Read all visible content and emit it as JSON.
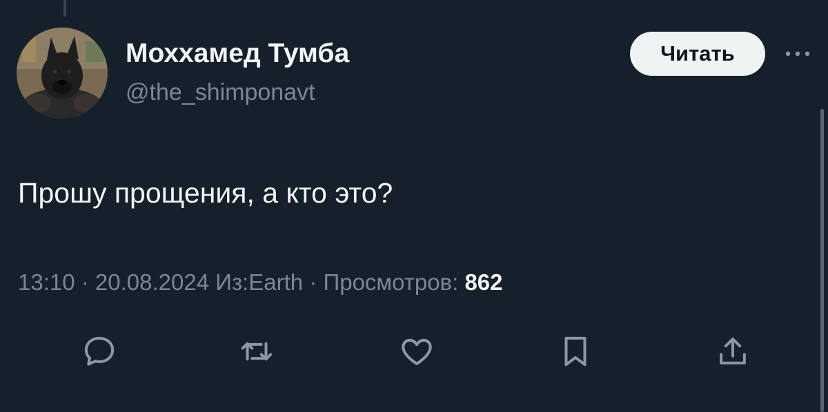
{
  "author": {
    "display_name": "Мохxамед Тумба",
    "handle": "@the_shimponavt"
  },
  "follow_button": {
    "label": "Читать"
  },
  "tweet": {
    "text": "Прошу прощения, а кто это?"
  },
  "meta": {
    "time": "13:10",
    "separator": " · ",
    "date": "20.08.2024",
    "source": "Из:Earth",
    "views_label": "Просмотров: ",
    "views_count": "862"
  },
  "actions": [
    {
      "name": "reply",
      "icon": "speech-bubble-icon"
    },
    {
      "name": "repost",
      "icon": "repost-arrows-icon"
    },
    {
      "name": "like",
      "icon": "heart-icon"
    },
    {
      "name": "bookmark",
      "icon": "bookmark-icon"
    },
    {
      "name": "share",
      "icon": "share-upload-icon"
    }
  ],
  "colors": {
    "background": "#15202b",
    "primary_text": "#f2f4f5",
    "secondary_text": "#7b8793",
    "icon": "#8b98a5",
    "follow_button_bg": "#eff3f4"
  }
}
